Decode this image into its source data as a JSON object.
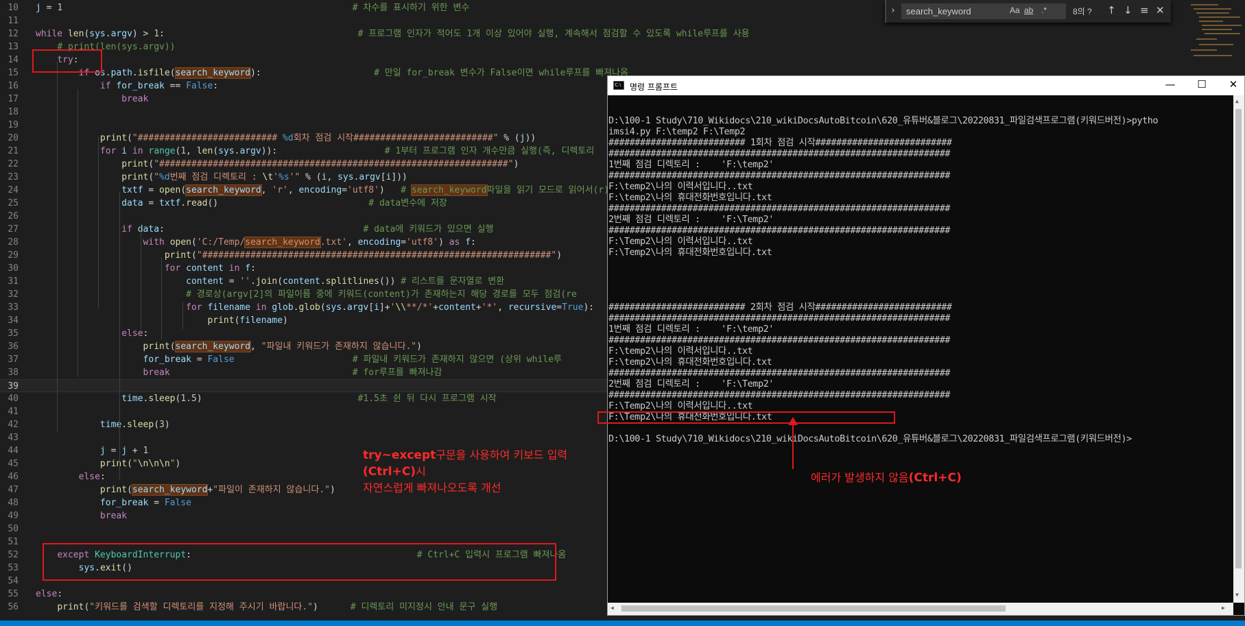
{
  "editor": {
    "lines": [
      {
        "n": "10",
        "html": "<span class='v'>j</span> = <span class='n'>1</span>                                                      <span class='c'># 차수를 표시하기 위한 변수</span>"
      },
      {
        "n": "11",
        "html": ""
      },
      {
        "n": "12",
        "html": "<span class='k'>while</span> <span class='f'>len</span>(<span class='v'>sys</span>.<span class='v'>argv</span>) &gt; <span class='n'>1</span>:                                    <span class='c'># 프로그램 인자가 적어도 1개 이상 있어야 실행, 계속해서 점검할 수 있도록 while루프를 사용</span>"
      },
      {
        "n": "13",
        "html": "    <span class='c'># print(len(sys.argv))</span>"
      },
      {
        "n": "14",
        "html": "    <span class='k'>try</span>:"
      },
      {
        "n": "15",
        "html": "        <span class='k'>if</span> <span class='v'>os</span>.<span class='v'>path</span>.<span class='f'>isfile</span>(<span class='v hl'>search_keyword</span>):                     <span class='c'># 만일 for_break 변수가 False이면 while루프를 빠져나옴</span>"
      },
      {
        "n": "16",
        "html": "            <span class='k'>if</span> <span class='v'>for_break</span> == <span class='b'>False</span>:"
      },
      {
        "n": "17",
        "html": "                <span class='k'>break</span>"
      },
      {
        "n": "18",
        "html": ""
      },
      {
        "n": "19",
        "html": ""
      },
      {
        "n": "20",
        "html": "            <span class='f'>print</span>(<span class='s'>\"########################## </span><span class='b'>%d</span><span class='s'>회차 점검 시작##########################\"</span> % (<span class='v'>j</span>))"
      },
      {
        "n": "21",
        "html": "            <span class='k'>for</span> <span class='v'>i</span> <span class='k'>in</span> <span class='t'>range</span>(<span class='n'>1</span>, <span class='f'>len</span>(<span class='v'>sys</span>.<span class='v'>argv</span>)):                    <span class='c'># 1부터 프로그램 인자 개수만큼 실행(즉, 디렉토리</span>"
      },
      {
        "n": "22",
        "html": "                <span class='f'>print</span>(<span class='s'>\"#################################################################\"</span>)"
      },
      {
        "n": "23",
        "html": "                <span class='f'>print</span>(<span class='s'>\"</span><span class='b'>%d</span><span class='s'>번째 점검 디렉토리 : </span><span class='f'>\\t</span><span class='s'>'</span><span class='b'>%s</span><span class='s'>'\"</span> % (<span class='v'>i</span>, <span class='v'>sys</span>.<span class='v'>argv</span>[<span class='v'>i</span>]))"
      },
      {
        "n": "24",
        "html": "                <span class='v'>txtf</span> = <span class='f'>open</span>(<span class='v hl'>search_keyword</span>, <span class='s'>'r'</span>, <span class='v'>encoding</span>=<span class='s'>'utf8'</span>)   <span class='c'># <span class='hl'>search_keyword</span>파일을 읽기 모드로 읽어서(r)</span>"
      },
      {
        "n": "25",
        "html": "                <span class='v'>data</span> = <span class='v'>txtf</span>.<span class='f'>read</span>()                            <span class='c'># data변수에 저장</span>"
      },
      {
        "n": "26",
        "html": ""
      },
      {
        "n": "27",
        "html": "                <span class='k'>if</span> <span class='v'>data</span>:                                     <span class='c'># data에 키워드가 있으면 실행</span>"
      },
      {
        "n": "28",
        "html": "                    <span class='k'>with</span> <span class='f'>open</span>(<span class='s'>'C:/Temp/<span class='hl'>search_keyword</span>.txt'</span>, <span class='v'>encoding</span>=<span class='s'>'utf8'</span>) <span class='k'>as</span> <span class='v'>f</span>:"
      },
      {
        "n": "29",
        "html": "                        <span class='f'>print</span>(<span class='s'>\"#################################################################\"</span>)"
      },
      {
        "n": "30",
        "html": "                        <span class='k'>for</span> <span class='v'>content</span> <span class='k'>in</span> <span class='v'>f</span>:"
      },
      {
        "n": "31",
        "html": "                            <span class='v'>content</span> = <span class='s'>''</span>.<span class='f'>join</span>(<span class='v'>content</span>.<span class='f'>splitlines</span>()) <span class='c'># 리스트를 문자열로 변환</span>"
      },
      {
        "n": "32",
        "html": "                            <span class='c'># 경로상(argv[2]의 파일이름 중에 키워드(content)가 존재하는지 해당 경로를 모두 점검(re</span>"
      },
      {
        "n": "33",
        "html": "                            <span class='k'>for</span> <span class='v'>filename</span> <span class='k'>in</span> <span class='v'>glob</span>.<span class='f'>glob</span>(<span class='v'>sys</span>.<span class='v'>argv</span>[<span class='v'>i</span>]+<span class='s'>'</span><span class='f'>\\\\</span><span class='s'>**/*'</span>+<span class='v'>content</span>+<span class='s'>'*'</span>, <span class='v'>recursive</span>=<span class='b'>True</span>):"
      },
      {
        "n": "34",
        "html": "                                <span class='f'>print</span>(<span class='v'>filename</span>)"
      },
      {
        "n": "35",
        "html": "                <span class='k'>else</span>:"
      },
      {
        "n": "36",
        "html": "                    <span class='f'>print</span>(<span class='v hl'>search_keyword</span>, <span class='s'>\"파일내 키워드가 존재하지 않습니다.\"</span>)"
      },
      {
        "n": "37",
        "html": "                    <span class='v'>for_break</span> = <span class='b'>False</span>                      <span class='c'># 파일내 키워드가 존재하지 않으면 (상위 while루</span>"
      },
      {
        "n": "38",
        "html": "                    <span class='k'>break</span>                                  <span class='c'># for루프를 빠져나감</span>"
      },
      {
        "n": "39",
        "html": ""
      },
      {
        "n": "40",
        "html": "                <span class='v'>time</span>.<span class='f'>sleep</span>(<span class='n'>1.5</span>)                             <span class='c'>#1.5초 쉰 뒤 다시 프로그램 시작</span>"
      },
      {
        "n": "41",
        "html": ""
      },
      {
        "n": "42",
        "html": "            <span class='v'>time</span>.<span class='f'>sleep</span>(<span class='n'>3</span>)"
      },
      {
        "n": "43",
        "html": ""
      },
      {
        "n": "44",
        "html": "            <span class='v'>j</span> = <span class='v'>j</span> + <span class='n'>1</span>"
      },
      {
        "n": "45",
        "html": "            <span class='f'>print</span>(<span class='s'>\"</span><span class='f'>\\n\\n\\n</span><span class='s'>\"</span>)"
      },
      {
        "n": "46",
        "html": "        <span class='k'>else</span>:"
      },
      {
        "n": "47",
        "html": "            <span class='f'>print</span>(<span class='v hl'>search_keyword</span>+<span class='s'>\"파일이 존재하지 않습니다.\"</span>)"
      },
      {
        "n": "48",
        "html": "            <span class='v'>for_break</span> = <span class='b'>False</span>"
      },
      {
        "n": "49",
        "html": "            <span class='k'>break</span>"
      },
      {
        "n": "50",
        "html": ""
      },
      {
        "n": "51",
        "html": ""
      },
      {
        "n": "52",
        "html": "    <span class='k'>except</span> <span class='t'>KeyboardInterrupt</span>:                                          <span class='c'># Ctrl+C 입력시 프로그램 빠져나옴</span>"
      },
      {
        "n": "53",
        "html": "        <span class='v'>sys</span>.<span class='f'>exit</span>()"
      },
      {
        "n": "54",
        "html": ""
      },
      {
        "n": "55",
        "html": "<span class='k'>else</span>:"
      },
      {
        "n": "56",
        "html": "    <span class='f'>print</span>(<span class='s'>\"키워드를 검색할 디렉토리를 지정해 주시기 바랍니다.\"</span>)      <span class='c'># 디렉토리 미지정시 안내 문구 실행</span>"
      }
    ]
  },
  "find": {
    "chevron": "›",
    "value": "search_keyword",
    "match_case": "Aa",
    "whole_word": "ab",
    "regex": ".*",
    "count": "8의 ?",
    "prev": "↑",
    "next": "↓",
    "selection": "≡",
    "close": "✕"
  },
  "cmd": {
    "title": "명령 프롬프트",
    "icon": "C:\\",
    "minimize": "—",
    "maximize": "☐",
    "close": "✕",
    "lines": [
      "",
      "D:\\100-1 Study\\710_Wikidocs\\210_wikiDocsAutoBitcoin\\620_유튜버&블로그\\20220831_파일검색프로그램(키워드버전)>pytho",
      "imsi4.py F:\\temp2 F:\\Temp2",
      "########################## 1회차 점검 시작##########################",
      "#################################################################",
      "1번째 점검 디렉토리 :    'F:\\temp2'",
      "#################################################################",
      "F:\\temp2\\나의 이력서입니다..txt",
      "F:\\temp2\\나의 휴대전화번호입니다.txt",
      "#################################################################",
      "2번째 점검 디렉토리 :    'F:\\Temp2'",
      "#################################################################",
      "F:\\Temp2\\나의 이력서입니다..txt",
      "F:\\Temp2\\나의 휴대전화번호입니다.txt",
      "",
      "",
      "",
      "",
      "########################## 2회차 점검 시작##########################",
      "#################################################################",
      "1번째 점검 디렉토리 :    'F:\\temp2'",
      "#################################################################",
      "F:\\temp2\\나의 이력서입니다..txt",
      "F:\\temp2\\나의 휴대전화번호입니다.txt",
      "#################################################################",
      "2번째 점검 디렉토리 :    'F:\\Temp2'",
      "#################################################################",
      "F:\\Temp2\\나의 이력서입니다..txt",
      "F:\\Temp2\\나의 휴대전화번호입니다.txt",
      "",
      "D:\\100-1 Study\\710_Wikidocs\\210_wikiDocsAutoBitcoin\\620_유튜버&블로그\\20220831_파일검색프로그램(키워드버전)>"
    ]
  },
  "annotations": {
    "left_line1_bold": "try~except",
    "left_line1_rest": "구문을 사용하여 키보드 입력",
    "left_line2_bold": "(Ctrl+C)",
    "left_line2_rest": "시",
    "left_line3": "자연스럽게 빠져나오도록 개선",
    "right_text": "에러가 발생하지 않음",
    "right_bold": "(Ctrl+C)"
  },
  "colors": {
    "accent": "#007acc",
    "annotation_red": "#e0181e"
  }
}
